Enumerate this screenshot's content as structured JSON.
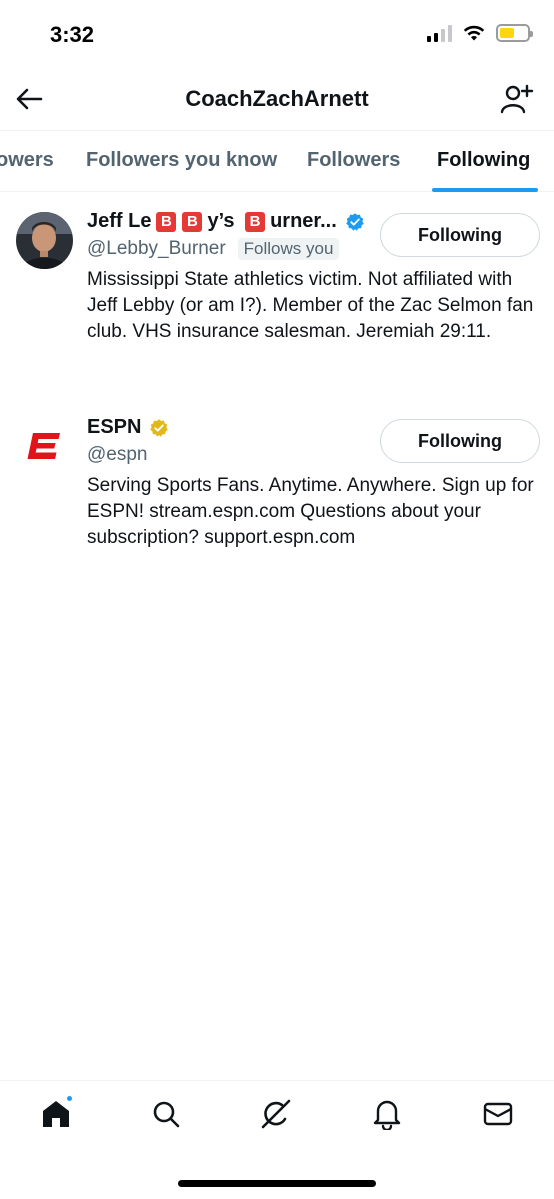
{
  "status_bar": {
    "time": "3:32"
  },
  "header": {
    "title": "CoachZachArnett"
  },
  "tabs": [
    {
      "label": "owers"
    },
    {
      "label": "Followers you know"
    },
    {
      "label": "Followers"
    },
    {
      "label": "Following"
    }
  ],
  "users": [
    {
      "name_prefix": "Jeff Le",
      "name_badge1": "B",
      "name_badge2": "B",
      "name_middle": "y’s ",
      "name_badge3": "B",
      "name_suffix": "urner...",
      "handle": "@Lebby_Burner",
      "follows_you": "Follows you",
      "bio": "Mississippi State athletics victim. Not affiliated with Jeff Lebby (or am I?). Member of the Zac Selmon fan club. VHS insurance salesman. Jeremiah 29:11.",
      "button": "Following",
      "verified_color": "#1d9bf0"
    },
    {
      "name": "ESPN",
      "handle": "@espn",
      "bio": "Serving Sports Fans. Anytime. Anywhere. Sign up for ESPN! stream.espn.com Questions about your subscription? support.espn.com",
      "button": "Following",
      "verified_color": "#e2b719",
      "logo_letter": "E"
    }
  ],
  "bottom_nav": [
    {
      "icon": "home-icon"
    },
    {
      "icon": "search-icon"
    },
    {
      "icon": "grok-icon"
    },
    {
      "icon": "bell-icon"
    },
    {
      "icon": "mail-icon"
    }
  ],
  "colors": {
    "accent": "#1d9bf0",
    "espn_red": "#e2141b"
  }
}
